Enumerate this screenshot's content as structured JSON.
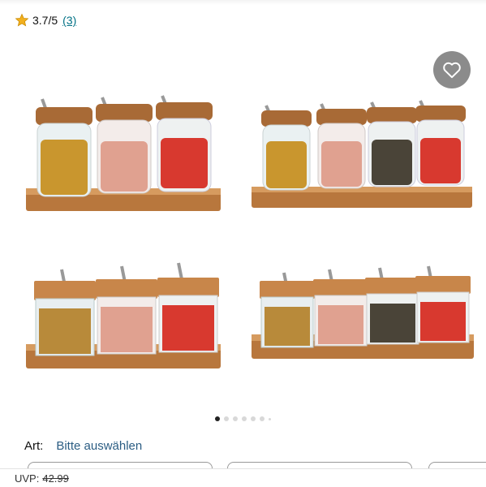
{
  "rating": {
    "score": "3.7/5",
    "count": "(3)"
  },
  "gallery": {
    "images": [
      {
        "name": "round-glass-jars-3-tray"
      },
      {
        "name": "round-glass-jars-4-tray"
      },
      {
        "name": "square-jars-3-tray"
      },
      {
        "name": "square-jars-4-tray"
      }
    ],
    "dots_total": 7,
    "active_dot": 0
  },
  "favorite": {
    "icon": "heart-icon"
  },
  "variant": {
    "label": "Art:",
    "value": "Bitte auswählen"
  },
  "price": {
    "uvp_label": "UVP:",
    "uvp_value": "42.99"
  },
  "colors": {
    "link": "#007185",
    "variant_value": "#2b5d83",
    "star": "#f2b01e",
    "wood": "#c8864a",
    "fav_bg": "#8b8b8b"
  }
}
